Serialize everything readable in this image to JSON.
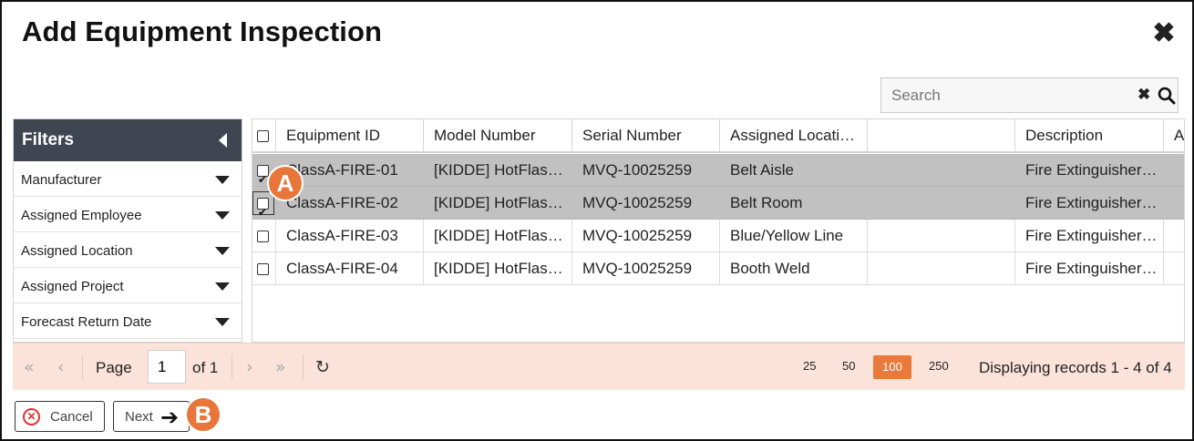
{
  "dialog": {
    "title": "Add Equipment Inspection",
    "close_glyph": "✖"
  },
  "search": {
    "placeholder": "Search",
    "clear_glyph": "✖"
  },
  "filters": {
    "title": "Filters",
    "items": [
      "Manufacturer",
      "Assigned Employee",
      "Assigned Location",
      "Assigned Project",
      "Forecast Return Date"
    ]
  },
  "grid": {
    "columns": [
      "Equipment ID",
      "Model Number",
      "Serial Number",
      "Assigned Locati…",
      "",
      "Description",
      "A"
    ],
    "rows": [
      {
        "selected": true,
        "cells": [
          "ClassA-FIRE-01",
          "[KIDDE] HotFlas…",
          "MVQ-10025259",
          "Belt Aisle",
          "",
          "Fire Extinguisher…",
          ""
        ]
      },
      {
        "selected": true,
        "cells": [
          "ClassA-FIRE-02",
          "[KIDDE] HotFlas…",
          "MVQ-10025259",
          "Belt Room",
          "",
          "Fire Extinguisher…",
          ""
        ]
      },
      {
        "selected": false,
        "cells": [
          "ClassA-FIRE-03",
          "[KIDDE] HotFlas…",
          "MVQ-10025259",
          "Blue/Yellow Line",
          "",
          "Fire Extinguisher…",
          ""
        ]
      },
      {
        "selected": false,
        "cells": [
          "ClassA-FIRE-04",
          "[KIDDE] HotFlas…",
          "MVQ-10025259",
          "Booth Weld",
          "",
          "Fire Extinguisher…",
          ""
        ]
      }
    ]
  },
  "pager": {
    "page_label": "Page",
    "page_value": "1",
    "of_label": "of 1",
    "page_sizes": [
      "25",
      "50",
      "100",
      "250"
    ],
    "active_page_size": "100",
    "display_text": "Displaying records 1 - 4 of 4",
    "icons": {
      "first": "«",
      "prev": "‹",
      "next": "›",
      "last": "»",
      "refresh": "↻"
    }
  },
  "buttons": {
    "cancel": "Cancel",
    "next": "Next",
    "next_arrow": "➔"
  },
  "callouts": {
    "a": "A",
    "b": "B"
  },
  "colors": {
    "accent": "#ea7a3a",
    "filter_header": "#3f4652",
    "selected_row": "#c1c1c1",
    "pager_bg": "#fbe3da",
    "callout": "#e8763a"
  }
}
